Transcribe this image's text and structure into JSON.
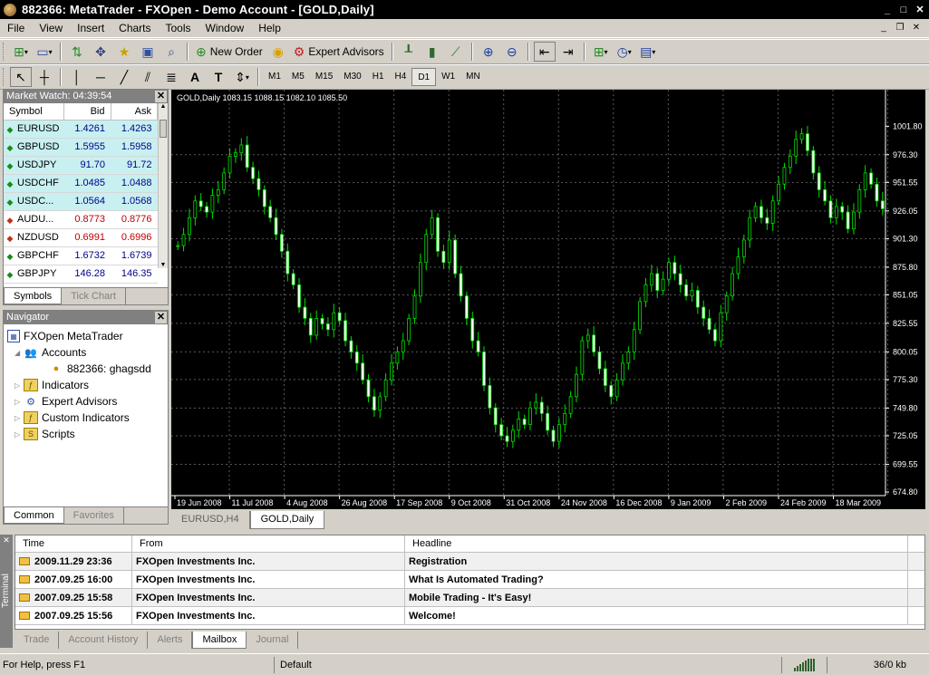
{
  "window": {
    "title": "882366: MetaTrader - FXOpen - Demo Account - [GOLD,Daily]"
  },
  "menu": [
    "File",
    "View",
    "Insert",
    "Charts",
    "Tools",
    "Window",
    "Help"
  ],
  "toolbar": {
    "new_order": "New Order",
    "expert_advisors": "Expert Advisors",
    "timeframes": [
      "M1",
      "M5",
      "M15",
      "M30",
      "H1",
      "H4",
      "D1",
      "W1",
      "MN"
    ],
    "active_timeframe": "D1"
  },
  "market_watch": {
    "title": "Market Watch: 04:39:54",
    "headers": [
      "Symbol",
      "Bid",
      "Ask"
    ],
    "rows": [
      {
        "symbol": "EURUSD",
        "bid": "1.4261",
        "ask": "1.4263",
        "dir": "up"
      },
      {
        "symbol": "GBPUSD",
        "bid": "1.5955",
        "ask": "1.5958",
        "dir": "up"
      },
      {
        "symbol": "USDJPY",
        "bid": "91.70",
        "ask": "91.72",
        "dir": "up"
      },
      {
        "symbol": "USDCHF",
        "bid": "1.0485",
        "ask": "1.0488",
        "dir": "up"
      },
      {
        "symbol": "USDC...",
        "bid": "1.0564",
        "ask": "1.0568",
        "dir": "up"
      },
      {
        "symbol": "AUDU...",
        "bid": "0.8773",
        "ask": "0.8776",
        "dir": "down"
      },
      {
        "symbol": "NZDUSD",
        "bid": "0.6991",
        "ask": "0.6996",
        "dir": "down"
      },
      {
        "symbol": "GBPCHF",
        "bid": "1.6732",
        "ask": "1.6739",
        "dir": "up"
      },
      {
        "symbol": "GBPJPY",
        "bid": "146.28",
        "ask": "146.35",
        "dir": "up"
      }
    ],
    "tabs": [
      "Symbols",
      "Tick Chart"
    ]
  },
  "navigator": {
    "title": "Navigator",
    "root": "FXOpen MetaTrader",
    "accounts": "Accounts",
    "account": "882366: ghagsdd",
    "items": [
      "Indicators",
      "Expert Advisors",
      "Custom Indicators",
      "Scripts"
    ],
    "tabs": [
      "Common",
      "Favorites"
    ]
  },
  "chart_data": {
    "type": "candlestick",
    "title": "GOLD,Daily  1083.15 1088.15 1082.10 1085.50",
    "yticks": [
      1001.8,
      976.3,
      951.55,
      926.05,
      901.3,
      875.8,
      851.05,
      825.55,
      800.05,
      775.3,
      749.8,
      725.05,
      699.55,
      674.8
    ],
    "ylim": [
      674.8,
      1015.0
    ],
    "xticks": [
      "19 Jun 2008",
      "11 Jul 2008",
      "4 Aug 2008",
      "26 Aug 2008",
      "17 Sep 2008",
      "9 Oct 2008",
      "31 Oct 2008",
      "24 Nov 2008",
      "16 Dec 2008",
      "9 Jan 2009",
      "2 Feb 2009",
      "24 Feb 2009",
      "18 Mar 2009"
    ],
    "grid": true,
    "close": [
      895,
      905,
      920,
      935,
      930,
      925,
      940,
      945,
      960,
      975,
      978,
      985,
      965,
      955,
      945,
      930,
      920,
      905,
      890,
      870,
      860,
      840,
      830,
      815,
      830,
      825,
      820,
      835,
      828,
      810,
      800,
      790,
      775,
      760,
      748,
      760,
      775,
      790,
      800,
      810,
      830,
      850,
      880,
      905,
      920,
      890,
      880,
      900,
      870,
      850,
      830,
      810,
      800,
      770,
      750,
      735,
      725,
      720,
      730,
      740,
      735,
      750,
      755,
      745,
      730,
      720,
      735,
      745,
      760,
      780,
      810,
      815,
      800,
      785,
      770,
      760,
      775,
      790,
      800,
      820,
      845,
      860,
      870,
      855,
      865,
      880,
      870,
      860,
      850,
      855,
      840,
      830,
      820,
      810,
      835,
      850,
      870,
      885,
      900,
      920,
      930,
      920,
      915,
      935,
      950,
      965,
      975,
      990,
      995,
      980,
      960,
      945,
      935,
      920,
      930,
      925,
      910,
      925,
      945,
      960,
      950,
      935,
      928
    ]
  },
  "chart_tabs": [
    "EURUSD,H4",
    "GOLD,Daily"
  ],
  "terminal": {
    "side_label": "Terminal",
    "headers": [
      "Time",
      "From",
      "Headline"
    ],
    "rows": [
      {
        "time": "2009.11.29 23:36",
        "from": "FXOpen Investments Inc.",
        "headline": "Registration"
      },
      {
        "time": "2007.09.25 16:00",
        "from": "FXOpen Investments Inc.",
        "headline": "What Is Automated Trading?"
      },
      {
        "time": "2007.09.25 15:58",
        "from": "FXOpen Investments Inc.",
        "headline": "Mobile Trading - It's Easy!"
      },
      {
        "time": "2007.09.25 15:56",
        "from": "FXOpen Investments Inc.",
        "headline": "Welcome!"
      }
    ],
    "tabs": [
      "Trade",
      "Account History",
      "Alerts",
      "Mailbox",
      "Journal"
    ],
    "active_tab": "Mailbox"
  },
  "status": {
    "help": "For Help, press F1",
    "profile": "Default",
    "traffic": "36/0 kb"
  }
}
